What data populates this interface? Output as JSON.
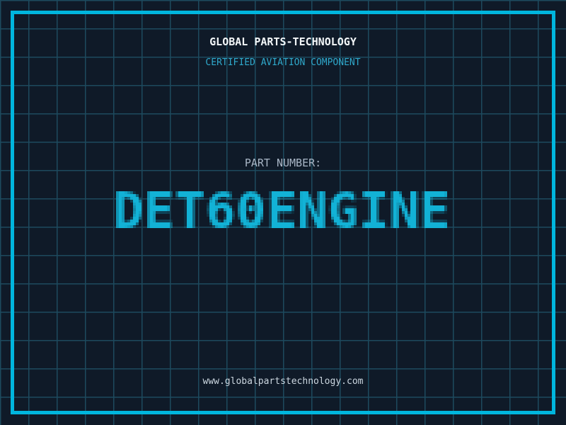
{
  "header": {
    "title": "GLOBAL PARTS-TECHNOLOGY",
    "subtitle": "CERTIFIED AVIATION COMPONENT"
  },
  "part": {
    "label": "PART NUMBER:",
    "value": "DET60ENGINE"
  },
  "footer": {
    "url": "www.globalpartstechnology.com"
  },
  "colors": {
    "background": "#0f1a28",
    "grid_line": "#1d4a5e",
    "frame": "#00b6de",
    "title": "#f2f6f8",
    "subtitle": "#2fa9cc",
    "part_label": "#a9b6c6",
    "part_number": "#12b2d6",
    "url": "#ccd7e0"
  }
}
